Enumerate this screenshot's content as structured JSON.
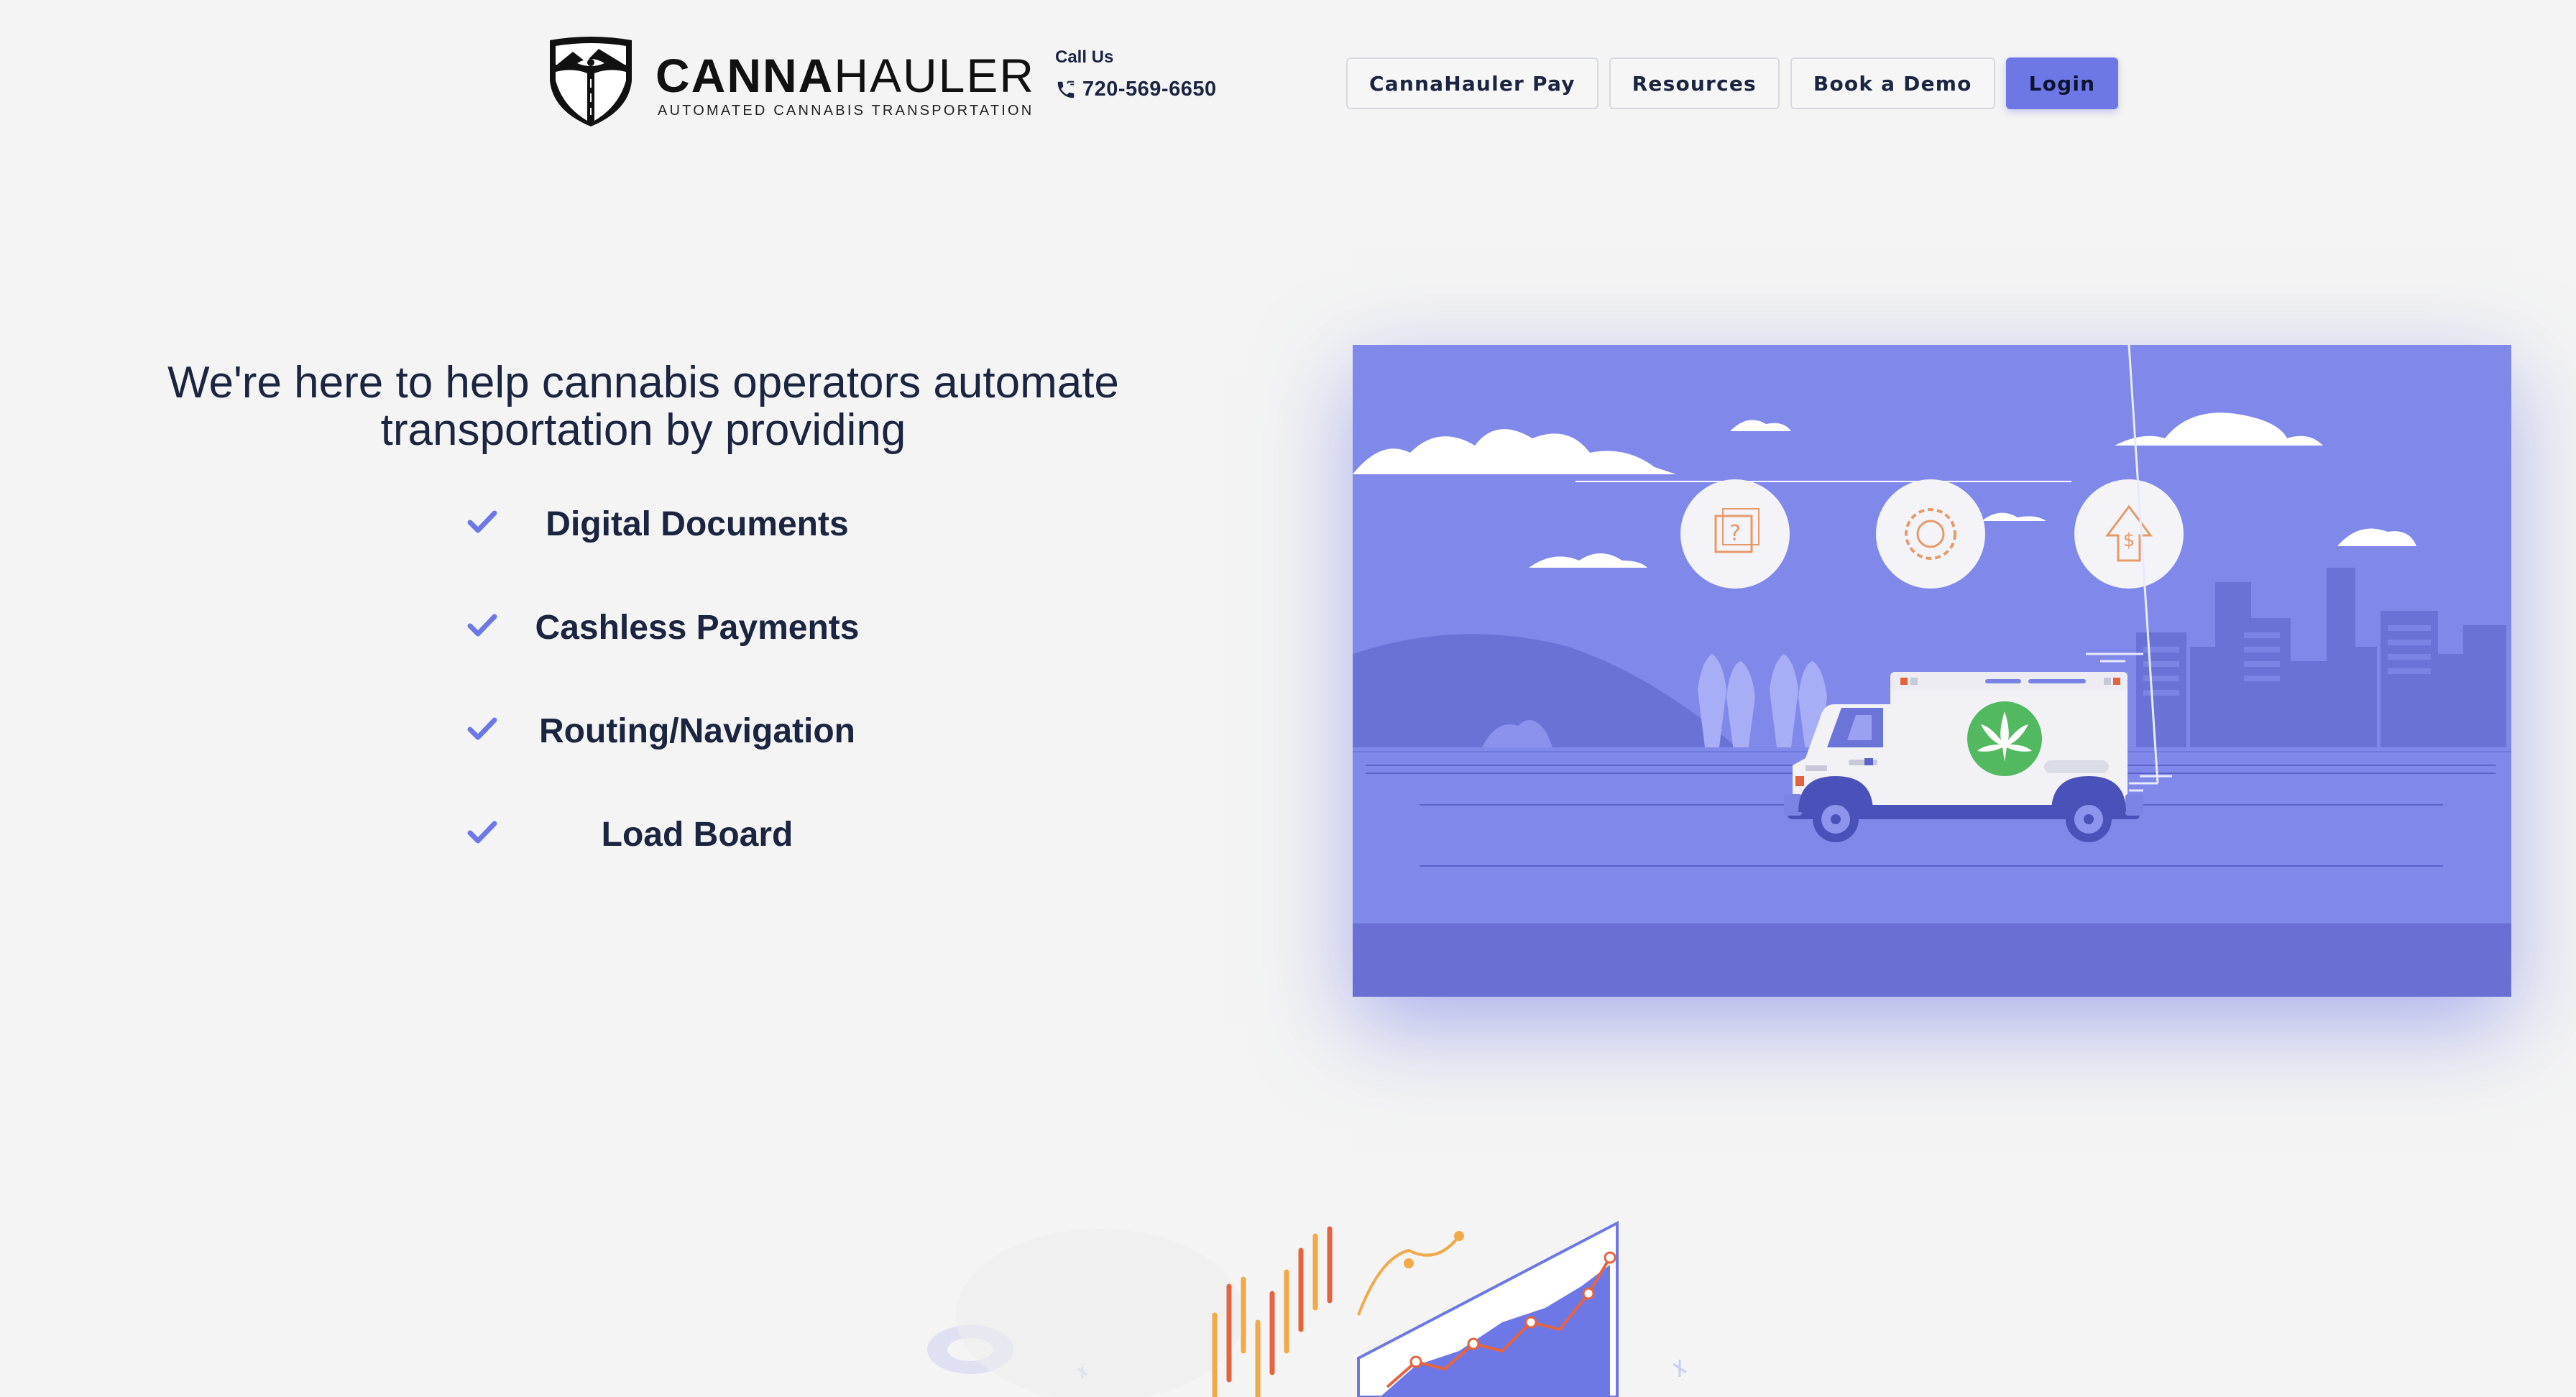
{
  "brand": {
    "name_bold": "CANNA",
    "name_light": "HAULER",
    "tagline": "AUTOMATED CANNABIS TRANSPORTATION",
    "logo_icon": "shield-road-mountains-icon"
  },
  "contact": {
    "label": "Call Us",
    "phone": "720-569-6650",
    "icon": "phone-icon"
  },
  "nav": {
    "items": [
      {
        "label": "CannaHauler Pay"
      },
      {
        "label": "Resources"
      },
      {
        "label": "Book a Demo"
      }
    ],
    "login_label": "Login"
  },
  "hero": {
    "heading_line1": "We're here to help cannabis operators automate",
    "heading_line2": "transportation by providing",
    "features": [
      {
        "label": "Digital Documents",
        "icon": "check-icon"
      },
      {
        "label": "Cashless Payments",
        "icon": "check-icon"
      },
      {
        "label": "Routing/Navigation",
        "icon": "check-icon"
      },
      {
        "label": "Load Board",
        "icon": "check-icon"
      }
    ],
    "illustration": "truck-city-illustration"
  },
  "colors": {
    "accent": "#6d78e6",
    "sky": "#8088ea",
    "text": "#1b2540",
    "check": "#6d78e6",
    "background": "#f4f4f4"
  }
}
